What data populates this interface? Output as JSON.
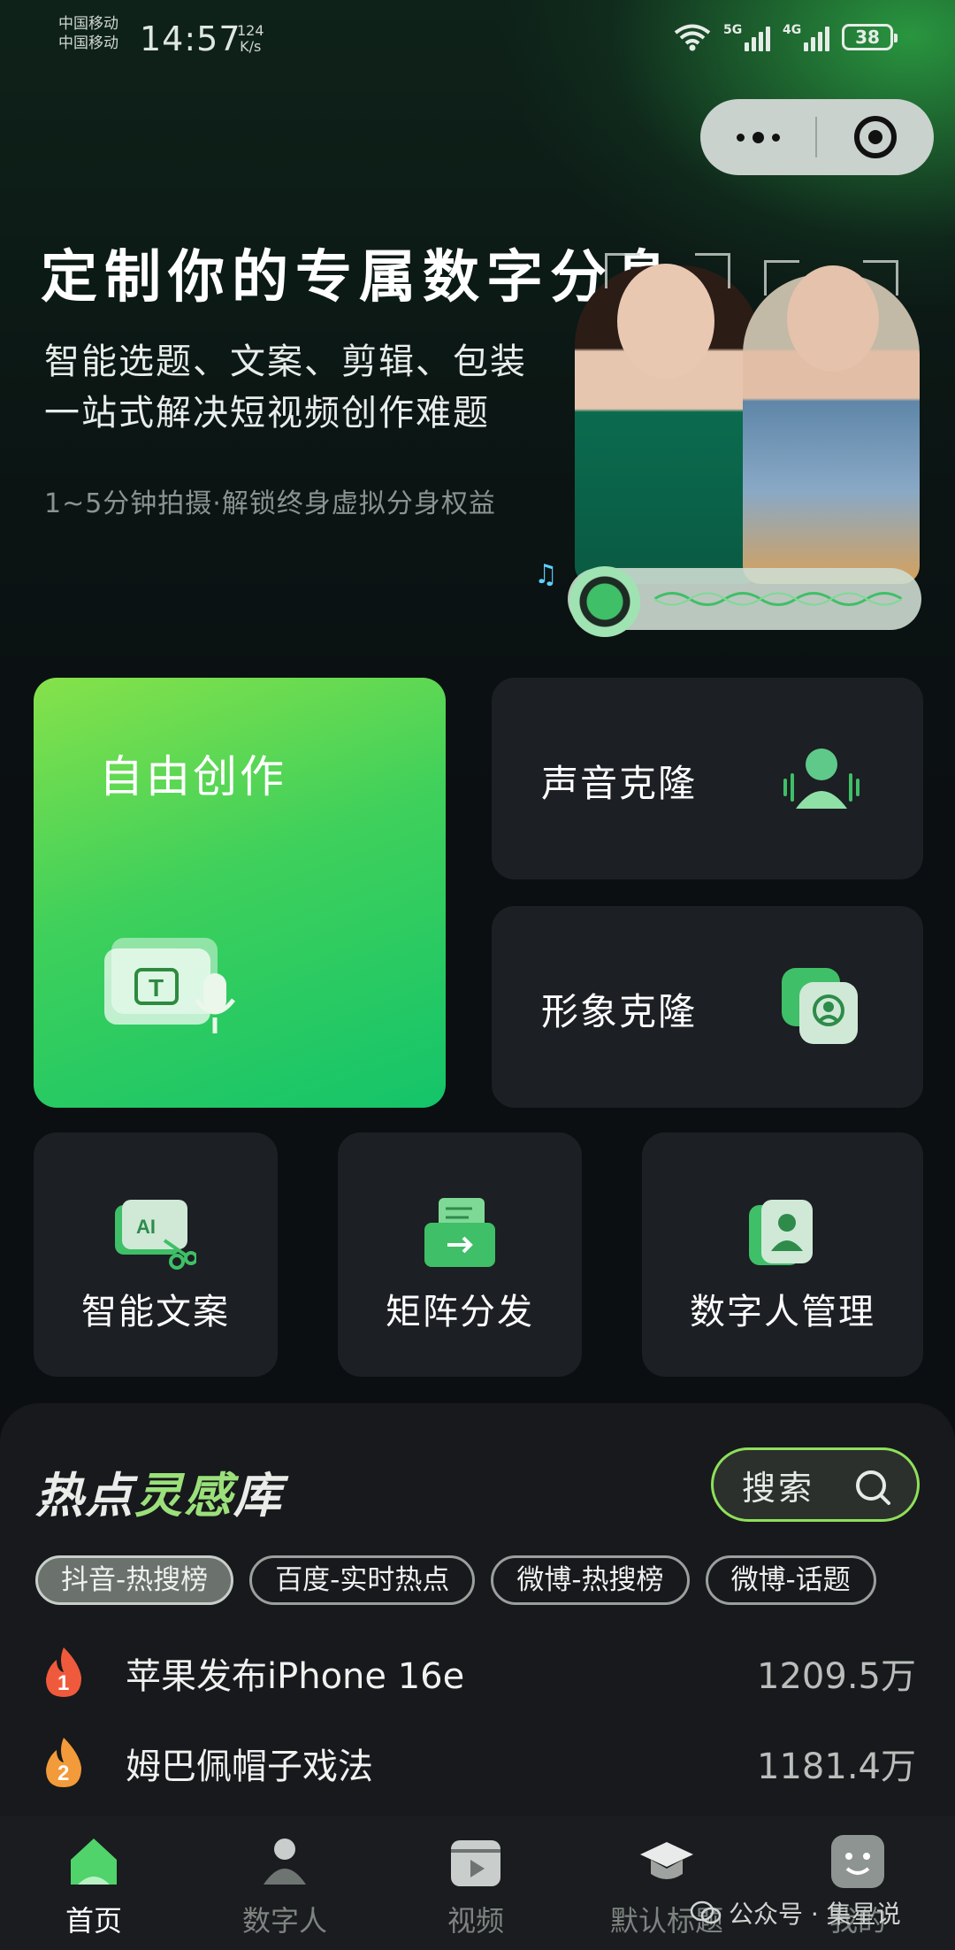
{
  "status_bar": {
    "carrier_line1": "中国移动",
    "carrier_line2": "中国移动",
    "time": "14:57",
    "net_speed_value": "124",
    "net_speed_unit": "K/s",
    "sig1_label": "5G",
    "sig2_label": "4G",
    "battery": "38"
  },
  "capsule": {
    "more_icon": "more-dots-icon",
    "close_icon": "target-icon"
  },
  "hero": {
    "title": "定制你的专属数字分身",
    "subtitle_line1": "智能选题、文案、剪辑、包装",
    "subtitle_line2": "一站式解决短视频创作难题",
    "note": "1~5分钟拍摄·解锁终身虚拟分身权益"
  },
  "features": {
    "free_creation": "自由创作",
    "voice_clone": "声音克隆",
    "image_clone": "形象克隆",
    "smart_copy": "智能文案",
    "matrix_dist": "矩阵分发",
    "digital_mgmt": "数字人管理"
  },
  "hot": {
    "title_part1": "热点",
    "title_part2": "灵感",
    "title_part3": "库",
    "search_label": "搜索",
    "tabs": [
      "抖音-热搜榜",
      "百度-实时热点",
      "微博-热搜榜",
      "微博-话题"
    ],
    "active_tab": 0,
    "items": [
      {
        "rank": "1",
        "title": "苹果发布iPhone 16e",
        "count": "1209.5万"
      },
      {
        "rank": "2",
        "title": "姆巴佩帽子戏法",
        "count": "1181.4万"
      }
    ]
  },
  "tabbar": {
    "items": [
      {
        "label": "首页",
        "icon": "home-icon"
      },
      {
        "label": "数字人",
        "icon": "person-icon"
      },
      {
        "label": "视频",
        "icon": "video-clapper-icon"
      },
      {
        "label": "默认标题",
        "icon": "graduation-cap-icon"
      },
      {
        "label": "我的",
        "icon": "smiley-face-icon"
      }
    ],
    "active": 0
  },
  "watermark": {
    "text": "公众号 · 集星说"
  },
  "colors": {
    "accent": "#3fd05b",
    "panel": "#17191c",
    "card": "#1c1f23"
  }
}
